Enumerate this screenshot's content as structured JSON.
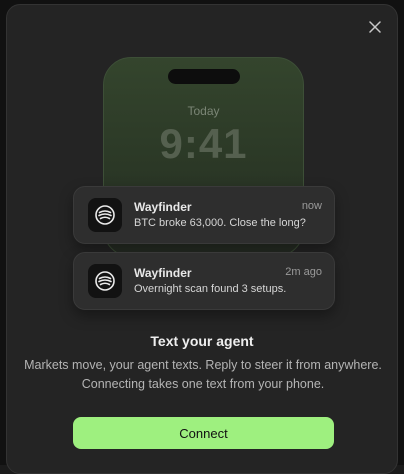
{
  "modal": {
    "close_icon": "close-icon"
  },
  "phone": {
    "day_label": "Today",
    "clock": "9:41"
  },
  "notifications": [
    {
      "icon": "wayfinder-logo-icon",
      "app": "Wayfinder",
      "time": "now",
      "message": "BTC broke 63,000. Close the long?"
    },
    {
      "icon": "wayfinder-logo-icon",
      "app": "Wayfinder",
      "time": "2m ago",
      "message": "Overnight scan found 3 setups."
    }
  ],
  "content": {
    "title": "Text your agent",
    "description_line1": "Markets move, your agent texts. Reply to steer it from anywhere.",
    "description_line2": "Connecting takes one text from your phone."
  },
  "actions": {
    "connect_label": "Connect"
  },
  "colors": {
    "accent": "#9ef07f",
    "surface": "#242424",
    "phone_tint": "#34452d"
  }
}
